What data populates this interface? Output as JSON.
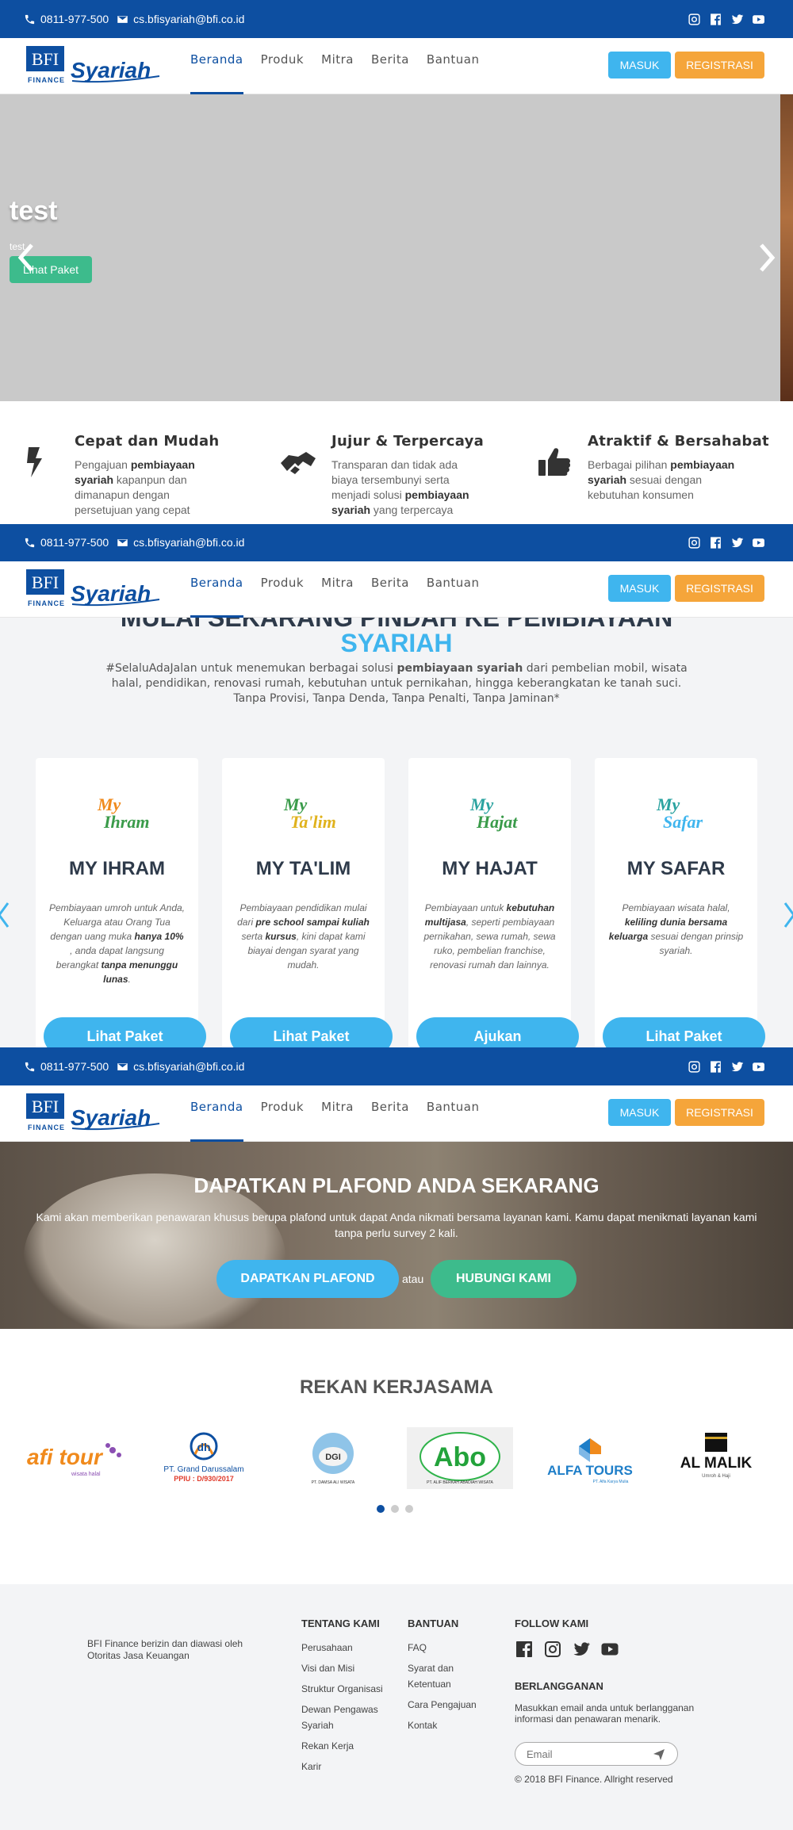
{
  "topbar": {
    "phone": "0811-977-500",
    "email": "cs.bfisyariah@bfi.co.id"
  },
  "brand": {
    "bfi": "BFI",
    "finance": "FINANCE",
    "syariah": "Syariah",
    "color": "#0d4fa1"
  },
  "nav": {
    "items": [
      "Beranda",
      "Produk",
      "Mitra",
      "Berita",
      "Bantuan"
    ],
    "active": "Beranda",
    "masuk": "MASUK",
    "registrasi": "REGISTRASI"
  },
  "hero": {
    "title": "test",
    "subtitle": "test",
    "button": "Lihat Paket"
  },
  "features": [
    {
      "title": "Cepat dan Mudah",
      "icon": "lightning-icon",
      "pre": "Pengajuan ",
      "bold": "pembiayaan syariah",
      "post": " kapanpun dan dimanapun dengan persetujuan yang cepat"
    },
    {
      "title": "Jujur & Terpercaya",
      "icon": "handshake-icon",
      "pre": "Transparan dan tidak ada biaya tersembunyi serta menjadi solusi ",
      "bold": "pembiayaan syariah",
      "post": " yang terpercaya"
    },
    {
      "title": "Atraktif & Bersahabat",
      "icon": "thumbs-up-icon",
      "pre": "Berbagai pilihan ",
      "bold": "pembiayaan syariah",
      "post": " sesuai dengan kebutuhan konsumen"
    }
  ],
  "products": {
    "heading_line1": "MULAI SEKARANG PINDAH KE PEMBIAYAAN",
    "heading_line2": "SYARIAH",
    "desc_pre": "#SelaluAdaJalan untuk menemukan berbagai solusi ",
    "desc_bold": "pembiayaan syariah",
    "desc_post": " dari pembelian mobil, wisata halal, pendidikan, renovasi rumah, kebutuhan untuk pernikahan, hingga keberangkatan ke tanah suci.",
    "desc_line2": "Tanpa Provisi, Tanpa Denda, Tanpa Penalti, Tanpa Jaminan*",
    "cards": [
      {
        "logo_top": "My",
        "logo_bottom": "Ihram",
        "title": "MY IHRAM",
        "button": "Lihat Paket",
        "parts": [
          "Pembiayaan umroh untuk Anda, Keluarga atau Orang Tua dengan uang muka ",
          "hanya 10%",
          " , anda dapat langsung berangkat ",
          "tanpa menunggu lunas",
          "."
        ]
      },
      {
        "logo_top": "My",
        "logo_bottom": "Ta'lim",
        "title": "MY TA'LIM",
        "button": "Lihat Paket",
        "parts": [
          "Pembiayaan pendidikan mulai dari ",
          "pre school sampai kuliah",
          " serta ",
          "kursus",
          ", kini dapat kami biayai dengan syarat yang mudah."
        ]
      },
      {
        "logo_top": "My",
        "logo_bottom": "Hajat",
        "title": "MY HAJAT",
        "button": "Ajukan",
        "parts": [
          "Pembiayaan untuk ",
          "kebutuhan multijasa",
          ", seperti pembiayaan pernikahan, sewa rumah, sewa ruko, pembelian franchise, renovasi rumah dan lainnya.",
          "",
          ""
        ]
      },
      {
        "logo_top": "My",
        "logo_bottom": "Safar",
        "title": "MY SAFAR",
        "button": "Lihat Paket",
        "parts": [
          "Pembiayaan wisata halal, ",
          "keliling dunia bersama keluarga",
          " sesuai dengan prinsip syariah.",
          "",
          ""
        ]
      }
    ]
  },
  "plafond": {
    "title": "DAPATKAN PLAFOND ANDA SEKARANG",
    "desc": "Kami akan memberikan penawaran khusus berupa plafond untuk dapat Anda nikmati bersama layanan kami. Kamu dapat menikmati layanan kami tanpa perlu survey 2 kali.",
    "button1": "DAPATKAN PLAFOND",
    "or": "atau",
    "button2": "HUBUNGI KAMI"
  },
  "partners": {
    "title": "REKAN KERJASAMA",
    "logos": [
      {
        "name": "afi tour",
        "caption": "wisata halal"
      },
      {
        "name": "PT. Grand Darussalam",
        "caption": "PPIU : D/930/2017"
      },
      {
        "name": "DGI",
        "caption": "PT. DAMSA ALI WISATA"
      },
      {
        "name": "Abo",
        "caption": "PT. ALIF BERKAH ABADIAH WISATA"
      },
      {
        "name": "ALFA TOURS",
        "caption": "PT. Alfa Karya Mulia"
      },
      {
        "name": "AL MALIK",
        "caption": "Umroh & Haji"
      }
    ]
  },
  "footer": {
    "legal": "BFI Finance berizin dan diawasi oleh Otoritas Jasa Keuangan",
    "col1": {
      "title": "TENTANG KAMI",
      "links": [
        "Perusahaan",
        "Visi dan Misi",
        "Struktur Organisasi",
        "Dewan Pengawas Syariah",
        "Rekan Kerja",
        "Karir"
      ]
    },
    "col2": {
      "title": "BANTUAN",
      "links": [
        "FAQ",
        "Syarat dan Ketentuan",
        "Cara Pengajuan",
        "Kontak"
      ]
    },
    "follow": "FOLLOW KAMI",
    "subscribe_title": "BERLANGGANAN",
    "subscribe_text": "Masukkan email anda untuk berlangganan informasi dan penawaran menarik.",
    "email_placeholder": "Email",
    "copyright": "© 2018 BFI Finance. Allright reserved"
  }
}
